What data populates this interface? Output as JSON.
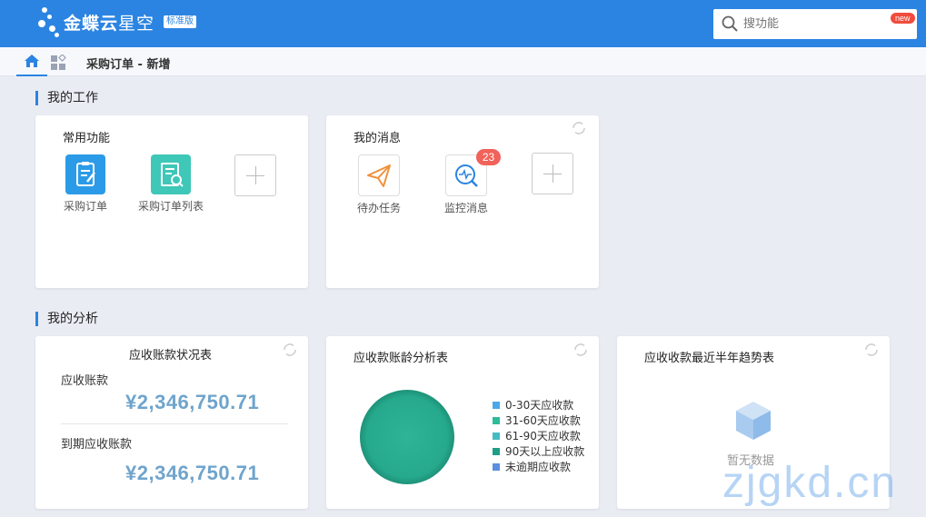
{
  "header": {
    "brand": "金蝶云",
    "brand_sub": "星空",
    "edition": "标准版",
    "search_placeholder": "搜功能",
    "new_badge": "new"
  },
  "tabs": {
    "active_title": "采购订单 - 新增"
  },
  "work": {
    "section_title": "我的工作",
    "common": {
      "title": "常用功能",
      "items": [
        {
          "label": "采购订单",
          "icon": "purchase-order-icon"
        },
        {
          "label": "采购订单列表",
          "icon": "order-list-icon"
        }
      ]
    },
    "messages": {
      "title": "我的消息",
      "items": [
        {
          "label": "待办任务",
          "icon": "paper-plane-icon"
        },
        {
          "label": "监控消息",
          "icon": "monitor-icon",
          "badge": "23"
        }
      ]
    }
  },
  "analysis": {
    "section_title": "我的分析",
    "receivable": {
      "title": "应收账款状况表",
      "label1": "应收账款",
      "amount1": "¥2,346,750.71",
      "label2": "到期应收账款",
      "amount2": "¥2,346,750.71"
    },
    "aging": {
      "title": "应收款账龄分析表",
      "legend": [
        {
          "label": "0-30天应收款",
          "color": "#4aa8e8"
        },
        {
          "label": "31-60天应收款",
          "color": "#2dbb9a"
        },
        {
          "label": "61-90天应收款",
          "color": "#45bcc4"
        },
        {
          "label": "90天以上应收款",
          "color": "#1f9e86"
        },
        {
          "label": "未逾期应收款",
          "color": "#5b8fe0"
        }
      ]
    },
    "trend": {
      "title": "应收收款最近半年趋势表",
      "empty": "暂无数据"
    }
  },
  "watermark": "zjgkd.cn",
  "colors": {
    "primary": "#2b84e2",
    "amount": "#6fa4cc",
    "badge": "#f0625a"
  }
}
